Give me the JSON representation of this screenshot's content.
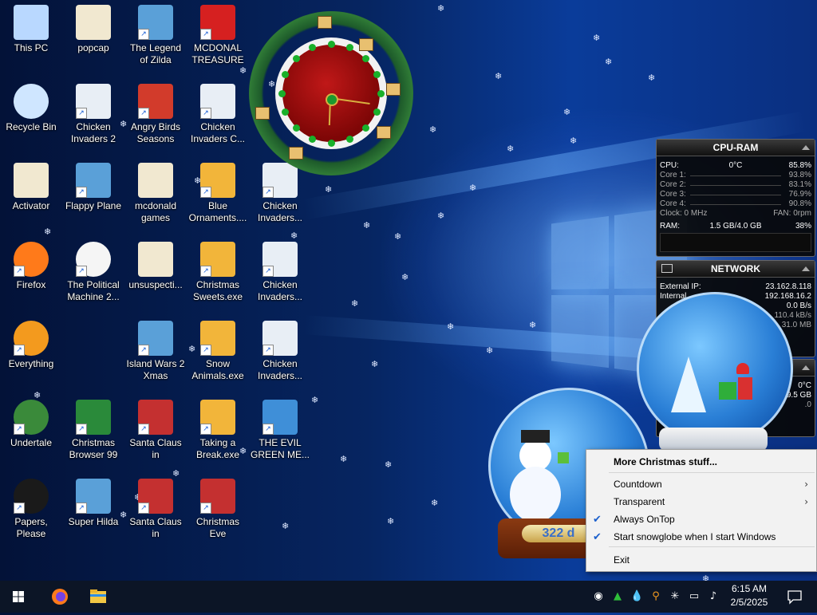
{
  "desktop_icons": [
    {
      "label": "This PC",
      "icon": "computer-icon",
      "shortcut": false
    },
    {
      "label": "popcap",
      "icon": "folder-icon",
      "shortcut": false
    },
    {
      "label": "The Legend\nof Zilda",
      "icon": "game-icon",
      "shortcut": true
    },
    {
      "label": "MCDONAL\nTREASURE",
      "icon": "mcdonalds-icon",
      "shortcut": true
    },
    {
      "label": "Recycle Bin",
      "icon": "recycle-bin-icon",
      "shortcut": false
    },
    {
      "label": "Chicken\nInvaders 2",
      "icon": "chicken-icon",
      "shortcut": true
    },
    {
      "label": "Angry Birds\nSeasons",
      "icon": "angry-birds-icon",
      "shortcut": true
    },
    {
      "label": "Chicken\nInvaders C...",
      "icon": "chicken-icon",
      "shortcut": true
    },
    {
      "label": "Activator",
      "icon": "folder-icon",
      "shortcut": false
    },
    {
      "label": "Flappy Plane",
      "icon": "game-icon",
      "shortcut": true
    },
    {
      "label": "mcdonald\ngames",
      "icon": "folder-icon",
      "shortcut": false
    },
    {
      "label": "Blue\nOrnaments....",
      "icon": "ornament-icon",
      "shortcut": true
    },
    {
      "label": "Chicken\nInvaders...",
      "icon": "chicken-icon",
      "shortcut": true
    },
    {
      "label": "Firefox",
      "icon": "firefox-icon",
      "shortcut": true
    },
    {
      "label": "The Political\nMachine 2...",
      "icon": "political-machine-icon",
      "shortcut": true
    },
    {
      "label": "unsuspecti...",
      "icon": "folder-icon",
      "shortcut": false
    },
    {
      "label": "Christmas\nSweets.exe",
      "icon": "ornament-icon",
      "shortcut": true
    },
    {
      "label": "Chicken\nInvaders...",
      "icon": "chicken-icon",
      "shortcut": true
    },
    {
      "label": "Everything",
      "icon": "search-icon",
      "shortcut": true
    },
    {
      "label": "Island Wars 2\nXmas",
      "icon": "game-icon",
      "shortcut": true
    },
    {
      "label": "Snow\nAnimals.exe",
      "icon": "ornament-icon",
      "shortcut": true
    },
    {
      "label": "Chicken\nInvaders...",
      "icon": "chicken-icon",
      "shortcut": true
    },
    {
      "label": "Undertale",
      "icon": "undertale-icon",
      "shortcut": true
    },
    {
      "label": "Christmas\nBrowser 99",
      "icon": "tree-icon",
      "shortcut": true
    },
    {
      "label": "Santa Claus in\nTrouble",
      "icon": "santa-icon",
      "shortcut": true
    },
    {
      "label": "Taking a\nBreak.exe",
      "icon": "ornament-icon",
      "shortcut": true
    },
    {
      "label": "THE EVIL\nGREEN ME...",
      "icon": "messenger-icon",
      "shortcut": true
    },
    {
      "label": "Papers, Please",
      "icon": "papers-please-icon",
      "shortcut": true
    },
    {
      "label": "Super Hilda",
      "icon": "game-icon",
      "shortcut": true
    },
    {
      "label": "Santa Claus in\nTrouble... A...",
      "icon": "santa-icon",
      "shortcut": true
    },
    {
      "label": "Christmas Eve\nCrisis",
      "icon": "santa-icon",
      "shortcut": true
    }
  ],
  "cpu_ram": {
    "title": "CPU-RAM",
    "cpu_label": "CPU:",
    "cpu_temp": "0°C",
    "cpu_pct": "85.8%",
    "cores": [
      {
        "label": "Core 1:",
        "value": "93.8%"
      },
      {
        "label": "Core 2:",
        "value": "83.1%"
      },
      {
        "label": "Core 3:",
        "value": "76.9%"
      },
      {
        "label": "Core 4:",
        "value": "90.8%"
      }
    ],
    "clock_label": "Clock: 0 MHz",
    "fan_label": "FAN: 0rpm",
    "ram_label": "RAM:",
    "ram_usage": "1.5 GB/4.0 GB",
    "ram_pct": "38%"
  },
  "network": {
    "title": "NETWORK",
    "external_ip_label": "External IP:",
    "external_ip": "23.162.8.118",
    "internal_ip_label": "Internal",
    "internal_ip": "192.168.16.2",
    "out_speed": "0.0 B/s",
    "in_speed": "110.4 kB/s",
    "total": "31.0 MB"
  },
  "third_gadget": {
    "line1": "0°C",
    "line2": "9.5 GB",
    "line3": ".0"
  },
  "snowglobe": {
    "counter": "322 d"
  },
  "context_menu": {
    "items": [
      {
        "label": "More Christmas stuff...",
        "bold": true
      },
      {
        "label": "Countdown",
        "submenu": true
      },
      {
        "label": "Transparent",
        "submenu": true
      },
      {
        "label": "Always OnTop",
        "checked": true
      },
      {
        "label": "Start snowglobe when I start Windows",
        "checked": true
      },
      {
        "label": "Exit"
      }
    ],
    "check_glyph": "✔",
    "submenu_glyph": "›"
  },
  "taskbar": {
    "time": "6:15 AM",
    "date": "2/5/2025",
    "pinned": [
      "windows-start-icon",
      "firefox-icon",
      "file-explorer-icon"
    ],
    "tray_icons": [
      "snowglobe-tray-icon",
      "tree-tray-icon",
      "droplet-icon",
      "search-tray-icon",
      "snowflake-icon",
      "network-icon",
      "volume-icon"
    ],
    "notification_icon": "action-center-icon"
  },
  "colors": {
    "accent": "#1a5fcc",
    "menu_bg": "#f2f2f2",
    "taskbar_bg": "#0c1526"
  }
}
